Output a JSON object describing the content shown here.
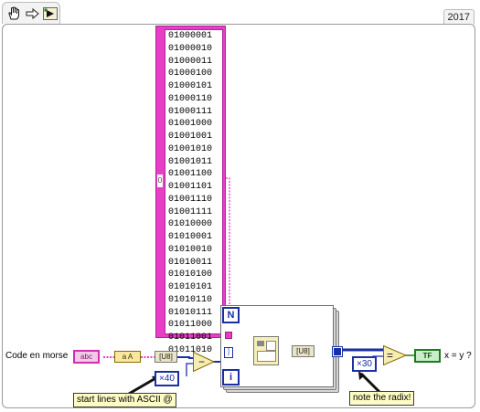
{
  "toolbar": {
    "icons": [
      "hand-icon",
      "arrow-icon",
      "run-icon"
    ]
  },
  "version_tab": "2017",
  "array_constant": {
    "index_glyph": "0",
    "values": [
      "01000001",
      "01000010",
      "01000011",
      "01000100",
      "01000101",
      "01000110",
      "01000111",
      "01001000",
      "01001001",
      "01001010",
      "01001011",
      "01001100",
      "01001101",
      "01001110",
      "01001111",
      "01010000",
      "01010001",
      "01010010",
      "01010011",
      "01010100",
      "01010101",
      "01010110",
      "01010111",
      "01011000",
      "01011001",
      "01011010"
    ]
  },
  "input": {
    "label": "Code en morse",
    "control_glyph": "abc"
  },
  "nodes": {
    "string_to_bytes": "a A",
    "u8_left": "[U8]",
    "u8_inner": "[U8]",
    "count_terminal": "N",
    "index_terminal": "i",
    "bool_indicator": "TF"
  },
  "constants": {
    "offset_40": "×40",
    "radix_30": "×30"
  },
  "comments": {
    "ascii_note": "start lines with ASCII @",
    "radix_note": "note the radix!"
  },
  "output": {
    "label": "x = y ?"
  },
  "colors": {
    "string_wire": "#e43ec2",
    "numeric_wire": "#1a2fa6",
    "boolean_wire": "#1e7b1e",
    "array_border": "#e83ec6"
  }
}
